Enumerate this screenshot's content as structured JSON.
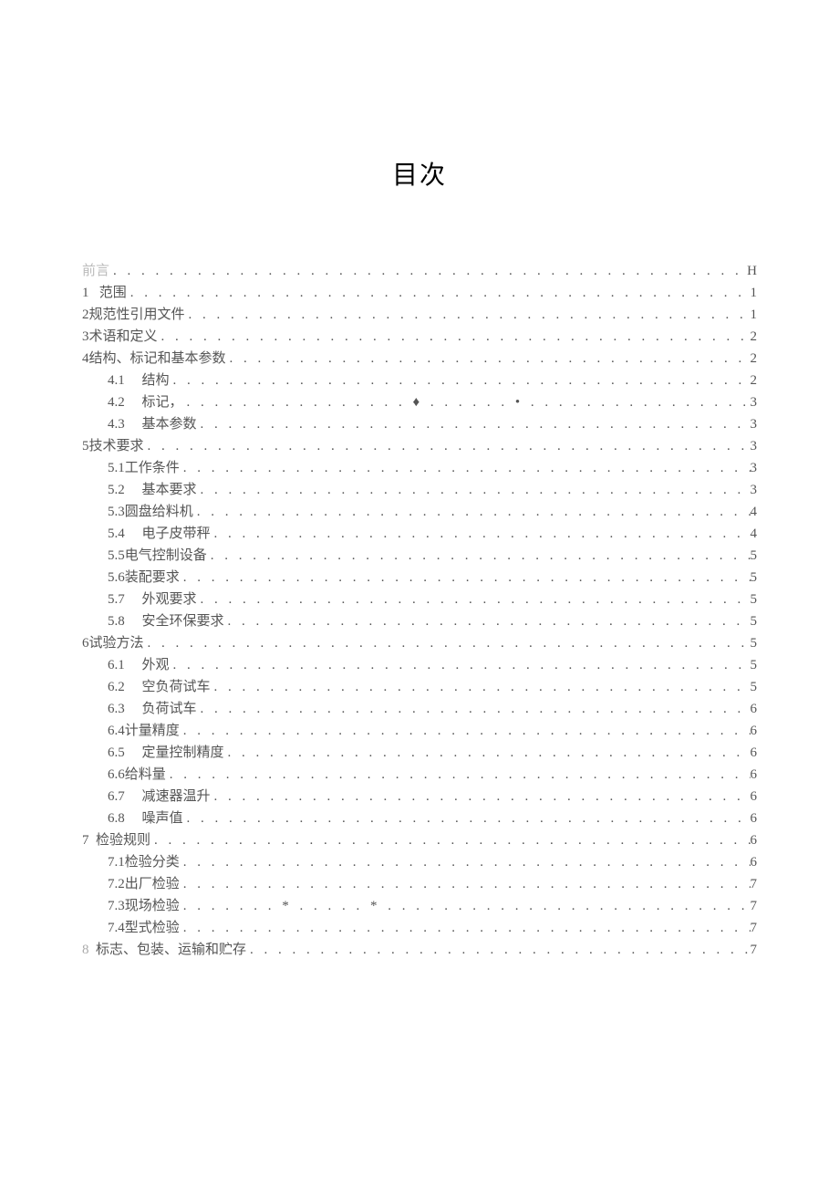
{
  "title": "目次",
  "dots": ". . . . . . . . . . . . . . . . . . . . . . . . . . . . . . . . . . . . . . . . . . . . . . . . . . . . . . . . . . . . . . . . . . . . . . . . . . . . . . . . . . . . . . . . . . . . . . . . . . . .",
  "entries": [
    {
      "level": 0,
      "num": "",
      "gap": "",
      "text": "前言",
      "page": "H",
      "dot_variant": "a",
      "faint": true
    },
    {
      "level": 0,
      "num": "1",
      "gap": "   ",
      "text": "范围",
      "page": "1",
      "dot_variant": "a"
    },
    {
      "level": 0,
      "num": "2",
      "gap": "",
      "text": "规范性引用文件",
      "page": "1",
      "dot_variant": "a"
    },
    {
      "level": 0,
      "num": "3",
      "gap": "",
      "text": "术语和定义",
      "page": "2",
      "dot_variant": "a"
    },
    {
      "level": 0,
      "num": "4",
      "gap": "",
      "text": "结构、标记和基本参数",
      "page": "2",
      "dot_variant": "a"
    },
    {
      "level": 1,
      "num": "4.1",
      "gap": "     ",
      "text": "结构",
      "page": "2",
      "dot_variant": "a"
    },
    {
      "level": 1,
      "num": "4.2",
      "gap": "     ",
      "text": "标记，",
      "page": "3",
      "dot_variant": "b"
    },
    {
      "level": 1,
      "num": "4.3",
      "gap": "     ",
      "text": "基本参数",
      "page": "3",
      "dot_variant": "a"
    },
    {
      "level": 0,
      "num": "5",
      "gap": "",
      "text": "技术要求",
      "page": "3",
      "dot_variant": "a"
    },
    {
      "level": 1,
      "num": "5.1",
      "gap": "",
      "text": "工作条件",
      "page": "3",
      "dot_variant": "a"
    },
    {
      "level": 1,
      "num": "5.2",
      "gap": "     ",
      "text": "基本要求",
      "page": "3",
      "dot_variant": "a"
    },
    {
      "level": 1,
      "num": "5.3",
      "gap": "",
      "text": "圆盘给料机",
      "page": "4",
      "dot_variant": "a"
    },
    {
      "level": 1,
      "num": "5.4",
      "gap": "     ",
      "text": "电子皮带秤",
      "page": "4",
      "dot_variant": "a"
    },
    {
      "level": 1,
      "num": "5.5",
      "gap": "",
      "text": "电气控制设备",
      "page": "5",
      "dot_variant": "a"
    },
    {
      "level": 1,
      "num": "5.6",
      "gap": "",
      "text": "装配要求",
      "page": "5",
      "dot_variant": "a"
    },
    {
      "level": 1,
      "num": "5.7",
      "gap": "     ",
      "text": "外观要求",
      "page": "5",
      "dot_variant": "a"
    },
    {
      "level": 1,
      "num": "5.8",
      "gap": "     ",
      "text": "安全环保要求",
      "page": "5",
      "dot_variant": "a"
    },
    {
      "level": 0,
      "num": "6",
      "gap": "",
      "text": "试验方法",
      "page": "5",
      "dot_variant": "a"
    },
    {
      "level": 1,
      "num": "6.1",
      "gap": "     ",
      "text": "外观",
      "page": "5",
      "dot_variant": "a"
    },
    {
      "level": 1,
      "num": "6.2",
      "gap": "     ",
      "text": "空负荷试车",
      "page": "5",
      "dot_variant": "a"
    },
    {
      "level": 1,
      "num": "6.3",
      "gap": "     ",
      "text": "负荷试车",
      "page": "6",
      "dot_variant": "a"
    },
    {
      "level": 1,
      "num": "6.4",
      "gap": "",
      "text": "计量精度",
      "page": "6",
      "dot_variant": "a"
    },
    {
      "level": 1,
      "num": "6.5",
      "gap": "     ",
      "text": "定量控制精度",
      "page": "6",
      "dot_variant": "a"
    },
    {
      "level": 1,
      "num": "6.6",
      "gap": "",
      "text": "给料量",
      "page": "6",
      "dot_variant": "a"
    },
    {
      "level": 1,
      "num": "6.7",
      "gap": "     ",
      "text": "减速器温升",
      "page": "6",
      "dot_variant": "a"
    },
    {
      "level": 1,
      "num": "6.8",
      "gap": "     ",
      "text": "噪声值",
      "page": "6",
      "dot_variant": "a"
    },
    {
      "level": 0,
      "num": "7",
      "gap": "  ",
      "text": "检验规则",
      "page": "6",
      "dot_variant": "a"
    },
    {
      "level": 1,
      "num": "7.1",
      "gap": "",
      "text": "检验分类",
      "page": "6",
      "dot_variant": "a"
    },
    {
      "level": 1,
      "num": "7.2",
      "gap": "",
      "text": "出厂检验",
      "page": "7",
      "dot_variant": "a"
    },
    {
      "level": 1,
      "num": "7.3",
      "gap": "",
      "text": "现场检验",
      "page": "7",
      "dot_variant": "c"
    },
    {
      "level": 1,
      "num": "7.4",
      "gap": "",
      "text": "型式检验",
      "page": "7",
      "dot_variant": "a"
    },
    {
      "level": 0,
      "num": "8",
      "gap": "  ",
      "text": "标志、包装、运输和贮存",
      "page": "7",
      "dot_variant": "a",
      "faint_num": true
    }
  ],
  "dot_variants": {
    "a": ". . . . . . . . . . . . . . . . . . . . . . . . . . . . . . . . . . . . . . . . . . . . . . . . . . . . . . . . . . . . . . . . . . . . . . . . . . . . . . . . . . . . . . . . . . . . . . . . . . . .",
    "b": ". . . . . . . . . . . . . . . . ♦ . . . . . .   •  . . . . . . . . . . . . . . . . . . . . . . . . . . . . . . . . . . . . . . . . . . . . . . . . . . .",
    "c": ". . . . . . . * . . . . . * . . . . . . . . . . . . . . . . . . . . . . . . . . . . . . . . . . . . . . . . . . . . * . . . . . . . . . . ."
  }
}
